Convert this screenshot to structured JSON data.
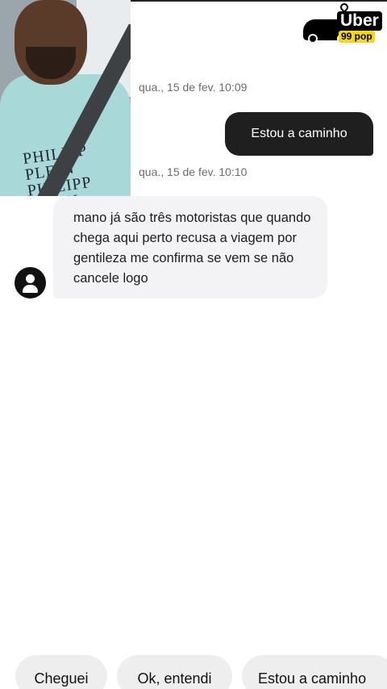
{
  "overlay": {
    "shirt_text_line1": "PHILIPP PLEIN",
    "shirt_text_line2": "PHILIPP PLEIN"
  },
  "logo": {
    "brand": "Uber",
    "product": "99 pop"
  },
  "chat": {
    "messages": [
      {
        "timestamp": "qua., 15 de fev. 10:09",
        "text": "Estou a caminho",
        "direction": "outgoing"
      },
      {
        "timestamp": "qua., 15 de fev. 10:10",
        "text": "mano já são três motoristas que quando chega aqui perto recusa a viagem por gentileza me confirma se vem se não cancele logo",
        "direction": "incoming"
      }
    ]
  },
  "quick_replies": [
    "Cheguei",
    "Ok, entendi",
    "Estou a caminho"
  ],
  "colors": {
    "outgoing_bubble": "#1f1f1f",
    "incoming_bubble": "#f3f3f6",
    "chip": "#eeeeee",
    "pop_badge": "#f3d51a"
  }
}
